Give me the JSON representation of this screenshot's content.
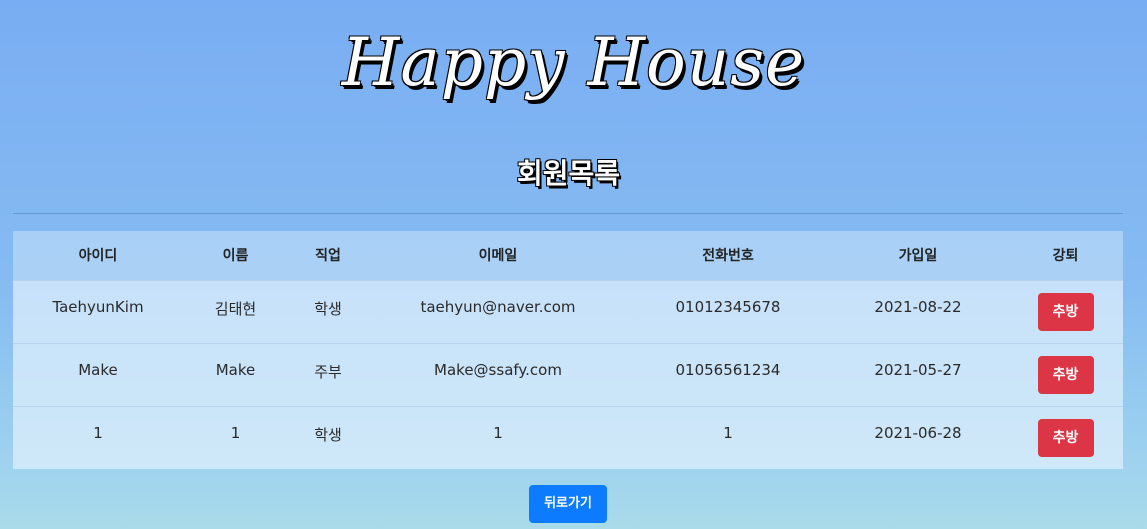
{
  "brand": "Happy House",
  "page_title": "회원목록",
  "table": {
    "headers": [
      "아이디",
      "이름",
      "직업",
      "이메일",
      "전화번호",
      "가입일",
      "강퇴"
    ],
    "rows": [
      {
        "id": "TaehyunKim",
        "name": "김태현",
        "job": "학생",
        "email": "taehyun@naver.com",
        "phone": "01012345678",
        "joined": "2021-08-22",
        "action": "추방"
      },
      {
        "id": "Make",
        "name": "Make",
        "job": "주부",
        "email": "Make@ssafy.com",
        "phone": "01056561234",
        "joined": "2021-05-27",
        "action": "추방"
      },
      {
        "id": "1",
        "name": "1",
        "job": "학생",
        "email": "1",
        "phone": "1",
        "joined": "2021-06-28",
        "action": "추방"
      }
    ]
  },
  "back_button": "뒤로가기",
  "colors": {
    "kick_button": "#dc3545",
    "back_button": "#0d7bfd"
  }
}
